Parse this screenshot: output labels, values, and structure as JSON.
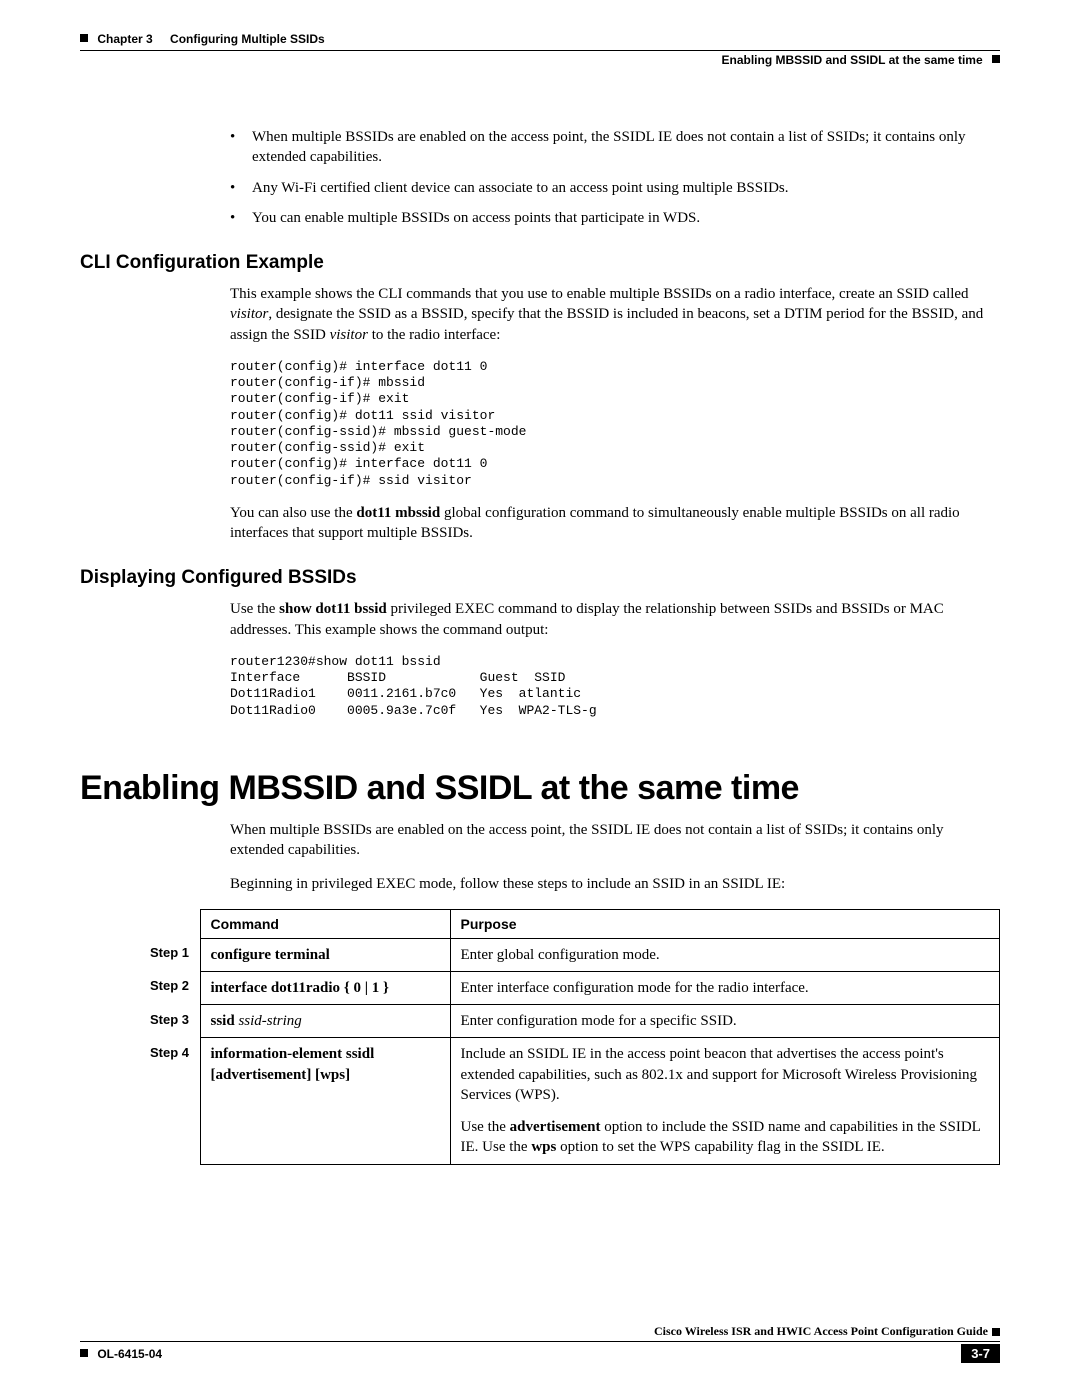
{
  "header": {
    "chapter_label": "Chapter 3",
    "chapter_title": "Configuring Multiple SSIDs",
    "section_right": "Enabling MBSSID and SSIDL at the same time"
  },
  "intro_bullets": [
    "When multiple BSSIDs are enabled on the access point, the SSIDL IE does not contain a list of SSIDs; it contains only extended capabilities.",
    "Any Wi-Fi certified client device can associate to an access point using multiple BSSIDs.",
    "You can enable multiple BSSIDs on access points that participate in WDS."
  ],
  "section_cli": {
    "heading": "CLI Configuration Example",
    "intro_pre": "This example shows the CLI commands that you use to enable multiple BSSIDs on a radio interface, create an SSID called ",
    "intro_ital1": "visitor",
    "intro_mid": ", designate the SSID as a BSSID, specify that the BSSID is included in beacons, set a DTIM period for the BSSID, and assign the SSID ",
    "intro_ital2": "visitor",
    "intro_post": " to the radio interface:",
    "code": "router(config)# interface dot11 0\nrouter(config-if)# mbssid\nrouter(config-if)# exit\nrouter(config)# dot11 ssid visitor\nrouter(config-ssid)# mbssid guest-mode\nrouter(config-ssid)# exit\nrouter(config)# interface dot11 0\nrouter(config-if)# ssid visitor",
    "outro_pre": "You can also use the ",
    "outro_bold": "dot11 mbssid",
    "outro_post": " global configuration command to simultaneously enable multiple BSSIDs on all radio interfaces that support multiple BSSIDs."
  },
  "section_display": {
    "heading": "Displaying Configured BSSIDs",
    "intro_pre": "Use the ",
    "intro_bold": "show dot11 bssid",
    "intro_post": " privileged EXEC command to display the relationship between SSIDs and BSSIDs or MAC addresses. This example shows the command output:",
    "code": "router1230#show dot11 bssid\nInterface      BSSID            Guest  SSID\nDot11Radio1    0011.2161.b7c0   Yes  atlantic\nDot11Radio0    0005.9a3e.7c0f   Yes  WPA2-TLS-g"
  },
  "section_enable": {
    "heading": "Enabling MBSSID and SSIDL at the same time",
    "para1": "When multiple BSSIDs are enabled on the access point, the SSIDL IE does not contain a list of SSIDs; it contains only extended capabilities.",
    "para2": "Beginning in privileged EXEC mode, follow these steps to include an SSID in an SSIDL IE:"
  },
  "table": {
    "head_step": "",
    "head_command": "Command",
    "head_purpose": "Purpose",
    "rows": [
      {
        "step": "Step 1",
        "cmd_bold": "configure terminal",
        "cmd_rest": "",
        "purpose_plain": "Enter global configuration mode."
      },
      {
        "step": "Step 2",
        "cmd_bold": "interface dot11radio",
        "cmd_rest": " { 0 | 1 }",
        "purpose_plain": "Enter interface configuration mode for the radio interface."
      },
      {
        "step": "Step 3",
        "cmd_bold": "ssid",
        "cmd_ital": " ssid-string",
        "purpose_plain": "Enter configuration mode for a specific SSID."
      }
    ],
    "row4": {
      "step": "Step 4",
      "cmd_line1_bold": "information-element ssidl",
      "cmd_line2": "[advertisement] [wps]",
      "purpose1": "Include an SSIDL IE in the access point beacon that advertises the access point's extended capabilities, such as 802.1x and support for Microsoft Wireless Provisioning Services (WPS).",
      "purpose2_pre": "Use the ",
      "purpose2_b1": "advertisement",
      "purpose2_mid": " option to include the SSID name and capabilities in the SSIDL IE. Use the ",
      "purpose2_b2": "wps",
      "purpose2_post": " option to set the WPS capability flag in the SSIDL IE."
    }
  },
  "footer": {
    "doc_title": "Cisco Wireless ISR and HWIC Access Point Configuration Guide",
    "doc_id": "OL-6415-04",
    "page_num": "3-7"
  }
}
